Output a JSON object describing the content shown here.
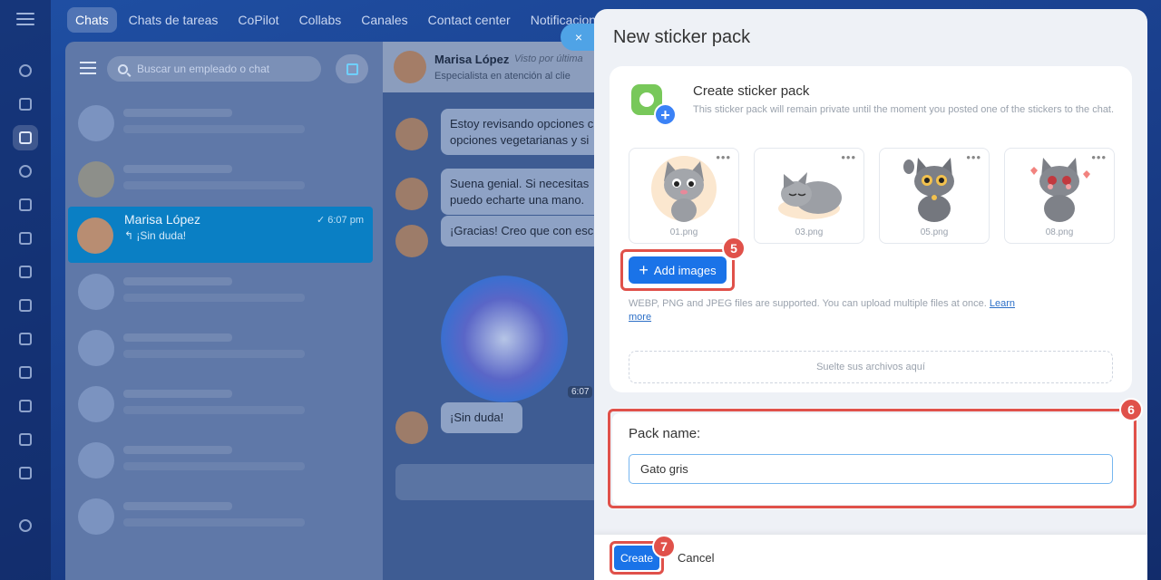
{
  "top_tabs": [
    "Chats",
    "Chats de tareas",
    "CoPilot",
    "Collabs",
    "Canales",
    "Contact center",
    "Notificaciones"
  ],
  "chat_list": {
    "search_placeholder": "Buscar un empleado o chat",
    "selected_chat": {
      "name": "Marisa López",
      "time": "✓ 6:07 pm",
      "preview": "↰ ¡Sin duda!"
    }
  },
  "conversation": {
    "contact_name": "Marisa López",
    "seen_text": "Visto por última",
    "role": "Especialista en atención al clie",
    "messages": [
      "Estoy revisando opciones c opciones vegetarianas y si",
      "Suena genial. Si necesitas puedo echarte una mano.",
      "¡Gracias! Creo que con esc",
      "¡Sin duda!"
    ],
    "sticker_time": "6:07"
  },
  "close_label": "×",
  "panel": {
    "title": "New sticker pack",
    "card_title": "Create sticker pack",
    "card_desc": "This sticker pack will remain private until the moment you posted one of the stickers to the chat.",
    "stickers": [
      {
        "file": "01.png",
        "more": "•••"
      },
      {
        "file": "03.png",
        "more": "•••"
      },
      {
        "file": "05.png",
        "more": "•••"
      },
      {
        "file": "08.png",
        "more": "•••"
      }
    ],
    "add_images_label": "Add images",
    "formats_text": "WEBP, PNG and JPEG files are supported. You can upload multiple files at once.",
    "learn_more": "Learn more",
    "dropzone_text": "Suelte sus archivos aquí",
    "pack_name_label": "Pack name:",
    "pack_name_value": "Gato gris",
    "create_label": "Create",
    "cancel_label": "Cancel"
  },
  "steps": [
    "5",
    "6",
    "7"
  ],
  "colors": {
    "accent": "#1a73e8",
    "highlight": "#e0514a"
  }
}
